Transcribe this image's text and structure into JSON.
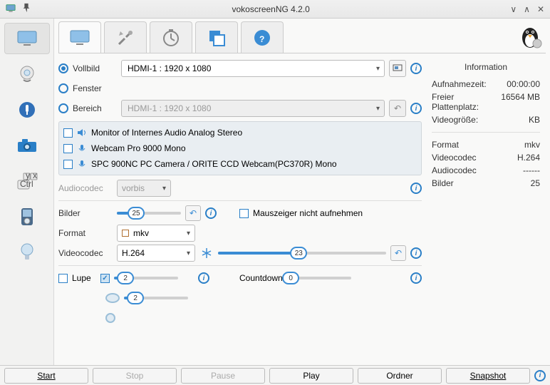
{
  "title": "vokoscreenNG 4.2.0",
  "capture": {
    "vollbild_label": "Vollbild",
    "vollbild_combo": "HDMI-1 :  1920 x 1080",
    "fenster_label": "Fenster",
    "bereich_label": "Bereich",
    "bereich_combo": "HDMI-1 :  1920 x 1080"
  },
  "audio": {
    "item0": "Monitor of Internes Audio Analog Stereo",
    "item1": "Webcam Pro 9000 Mono",
    "item2": "SPC 900NC PC Camera / ORITE CCD Webcam(PC370R) Mono",
    "codec_label": "Audiocodec",
    "codec_value": "vorbis"
  },
  "settings": {
    "bilder_label": "Bilder",
    "bilder_value": "25",
    "mauszeiger_label": "Mauszeiger nicht aufnehmen",
    "format_label": "Format",
    "format_value": "mkv",
    "videocodec_label": "Videocodec",
    "videocodec_value": "H.264",
    "videocodec_slider": "23",
    "lupe_label": "Lupe",
    "lupe_slider1": "2",
    "lupe_slider2": "2",
    "countdown_label": "Countdown",
    "countdown_value": "0"
  },
  "info": {
    "heading": "Information",
    "rectime_l": "Aufnahmezeit:",
    "rectime_v": "00:00:00",
    "free_l": "Freier Plattenplatz:",
    "free_v": "16564",
    "free_u": "MB",
    "size_l": "Videogröße:",
    "size_u": "KB",
    "format_l": "Format",
    "format_v": "mkv",
    "vcodec_l": "Videocodec",
    "vcodec_v": "H.264",
    "acodec_l": "Audiocodec",
    "acodec_v": "------",
    "bilder_l": "Bilder",
    "bilder_v": "25"
  },
  "footer": {
    "start": "Start",
    "stop": "Stop",
    "pause": "Pause",
    "play": "Play",
    "ordner": "Ordner",
    "snapshot": "Snapshot"
  }
}
